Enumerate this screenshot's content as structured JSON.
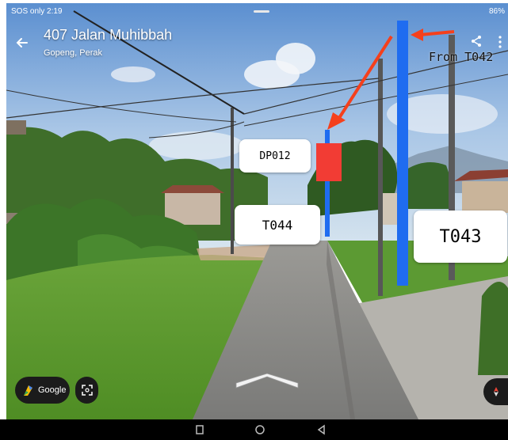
{
  "status_bar": {
    "left_text": "SOS only 2:19",
    "right_text": "86%"
  },
  "location": {
    "title": "407 Jalan Muhibbah",
    "subtitle": "Gopeng, Perak"
  },
  "annotations": {
    "from_label": "From T042",
    "dp_label": "DP012",
    "pole_left_label": "T044",
    "pole_right_label": "T043",
    "arrow_color": "#f5401c",
    "line_color": "#1f6cf0",
    "dp_box_color": "#f23c34"
  },
  "controls": {
    "google_label": "Google"
  },
  "icons": {
    "back": "arrow-back-icon",
    "share": "share-icon",
    "more": "more-vert-icon",
    "pegman": "pegman-icon",
    "fullscreen": "fullscreen-icon",
    "compass": "compass-icon",
    "nav": "chevron-up-icon"
  }
}
